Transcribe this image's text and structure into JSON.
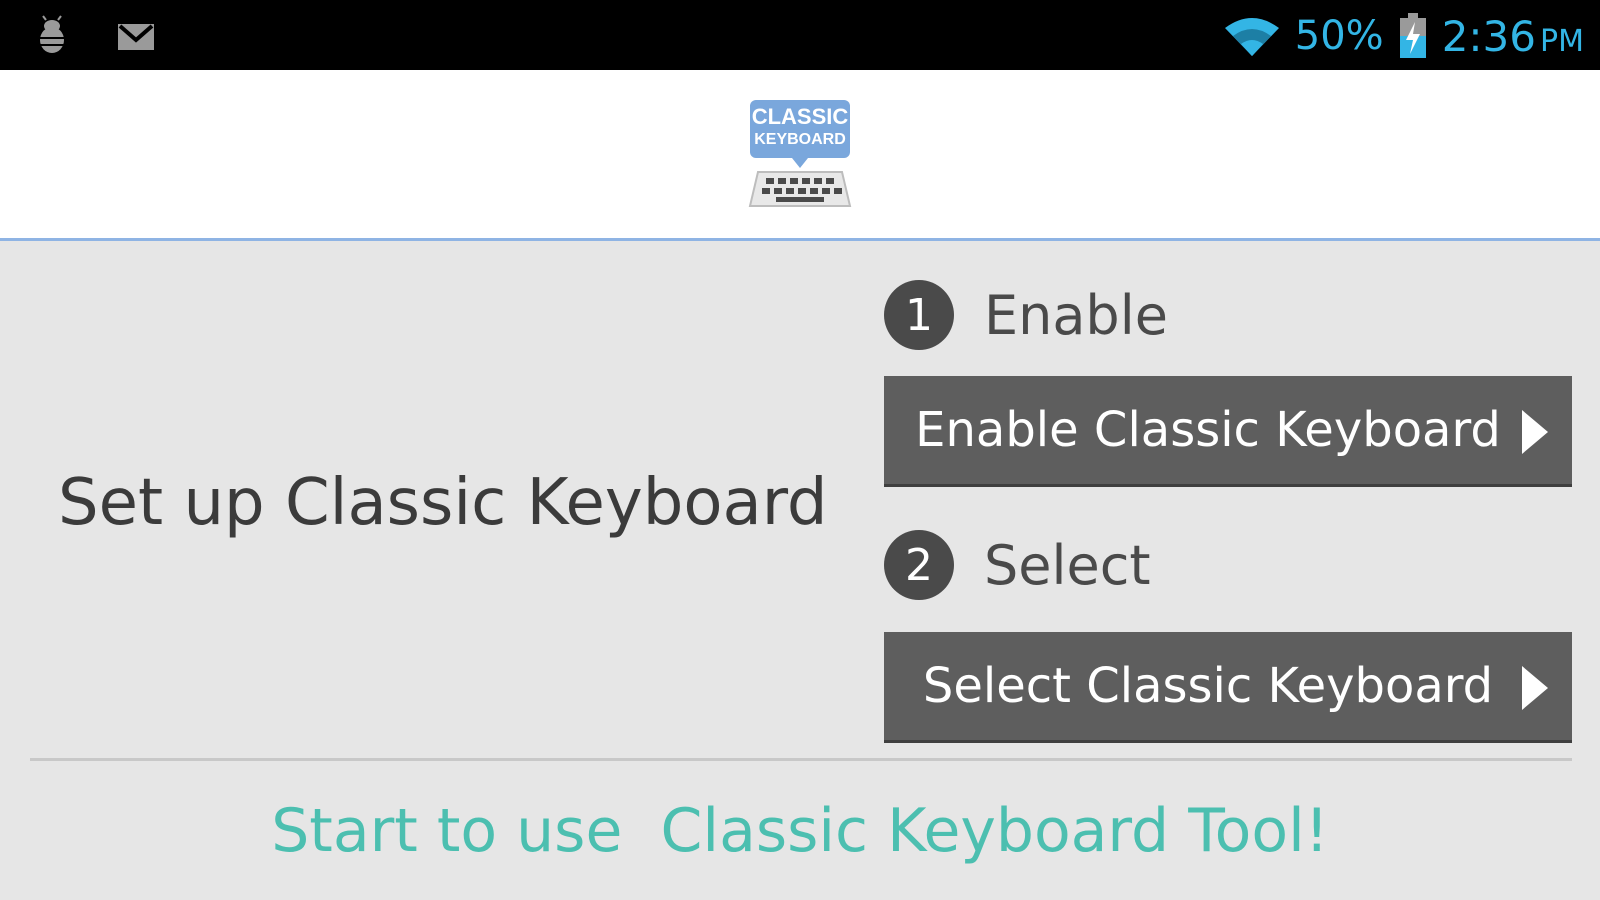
{
  "status_bar": {
    "icons_left": [
      "debug-bug-icon",
      "gmail-icon"
    ],
    "battery_percent": "50%",
    "time": "2:36",
    "ampm": "PM",
    "accent_color": "#33b5e5"
  },
  "header": {
    "logo_text_line1": "CLASSIC",
    "logo_text_line2": "KEYBOARD"
  },
  "main": {
    "title": "Set up Classic Keyboard",
    "steps": [
      {
        "number": "1",
        "label": "Enable",
        "button_label": "Enable Classic Keyboard"
      },
      {
        "number": "2",
        "label": "Select",
        "button_label": "Select Classic Keyboard"
      }
    ],
    "start_link": "Start to use  Classic Keyboard Tool!",
    "link_color": "#4cbfb0"
  }
}
